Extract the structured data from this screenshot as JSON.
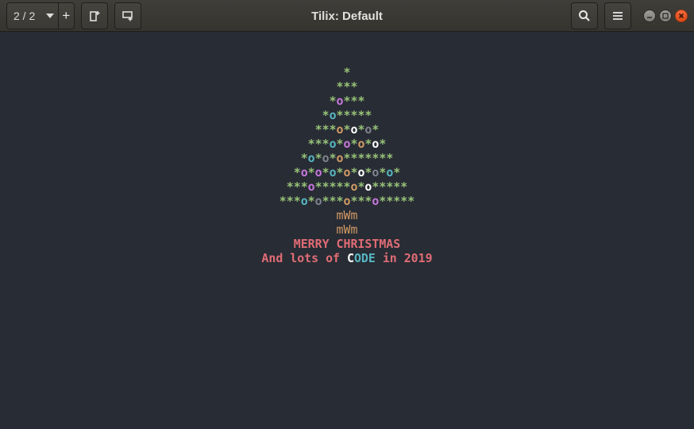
{
  "window": {
    "title": "Tilix: Default",
    "session_count": "2 / 2"
  },
  "colors": {
    "background": "#282c34",
    "star_green": "#98c379",
    "ornament_magenta": "#c678dd",
    "ornament_cyan": "#56b6c2",
    "ornament_orange": "#d19a66",
    "ornament_white": "#ffffff",
    "ornament_gray": "#7f848e",
    "greeting_red": "#e06c75"
  },
  "icons": {
    "add_session": "plus-icon",
    "add_terminal_right": "add-terminal-right-icon",
    "add_terminal_down": "add-terminal-down-icon",
    "find": "search-icon",
    "menu": "hamburger-icon",
    "minimize": "minimize-icon",
    "maximize": "maximize-icon",
    "close": "close-icon"
  },
  "terminal": {
    "tree_lines": [
      "*",
      "***",
      "*o***",
      "*o*****",
      "***o*o*o*",
      "***o*o*o*o*",
      "*o*o*o*******",
      "*o*o*o*o*o*o*o*",
      "***o*****o*o*****",
      "***o*o***o***o*****"
    ],
    "trunk_lines": [
      "mWm",
      "mWm"
    ],
    "greeting": "MERRY CHRISTMAS",
    "message": {
      "prefix": "And lots of ",
      "c_char": "C",
      "ode": "ODE",
      "suffix": " in 2019"
    }
  }
}
